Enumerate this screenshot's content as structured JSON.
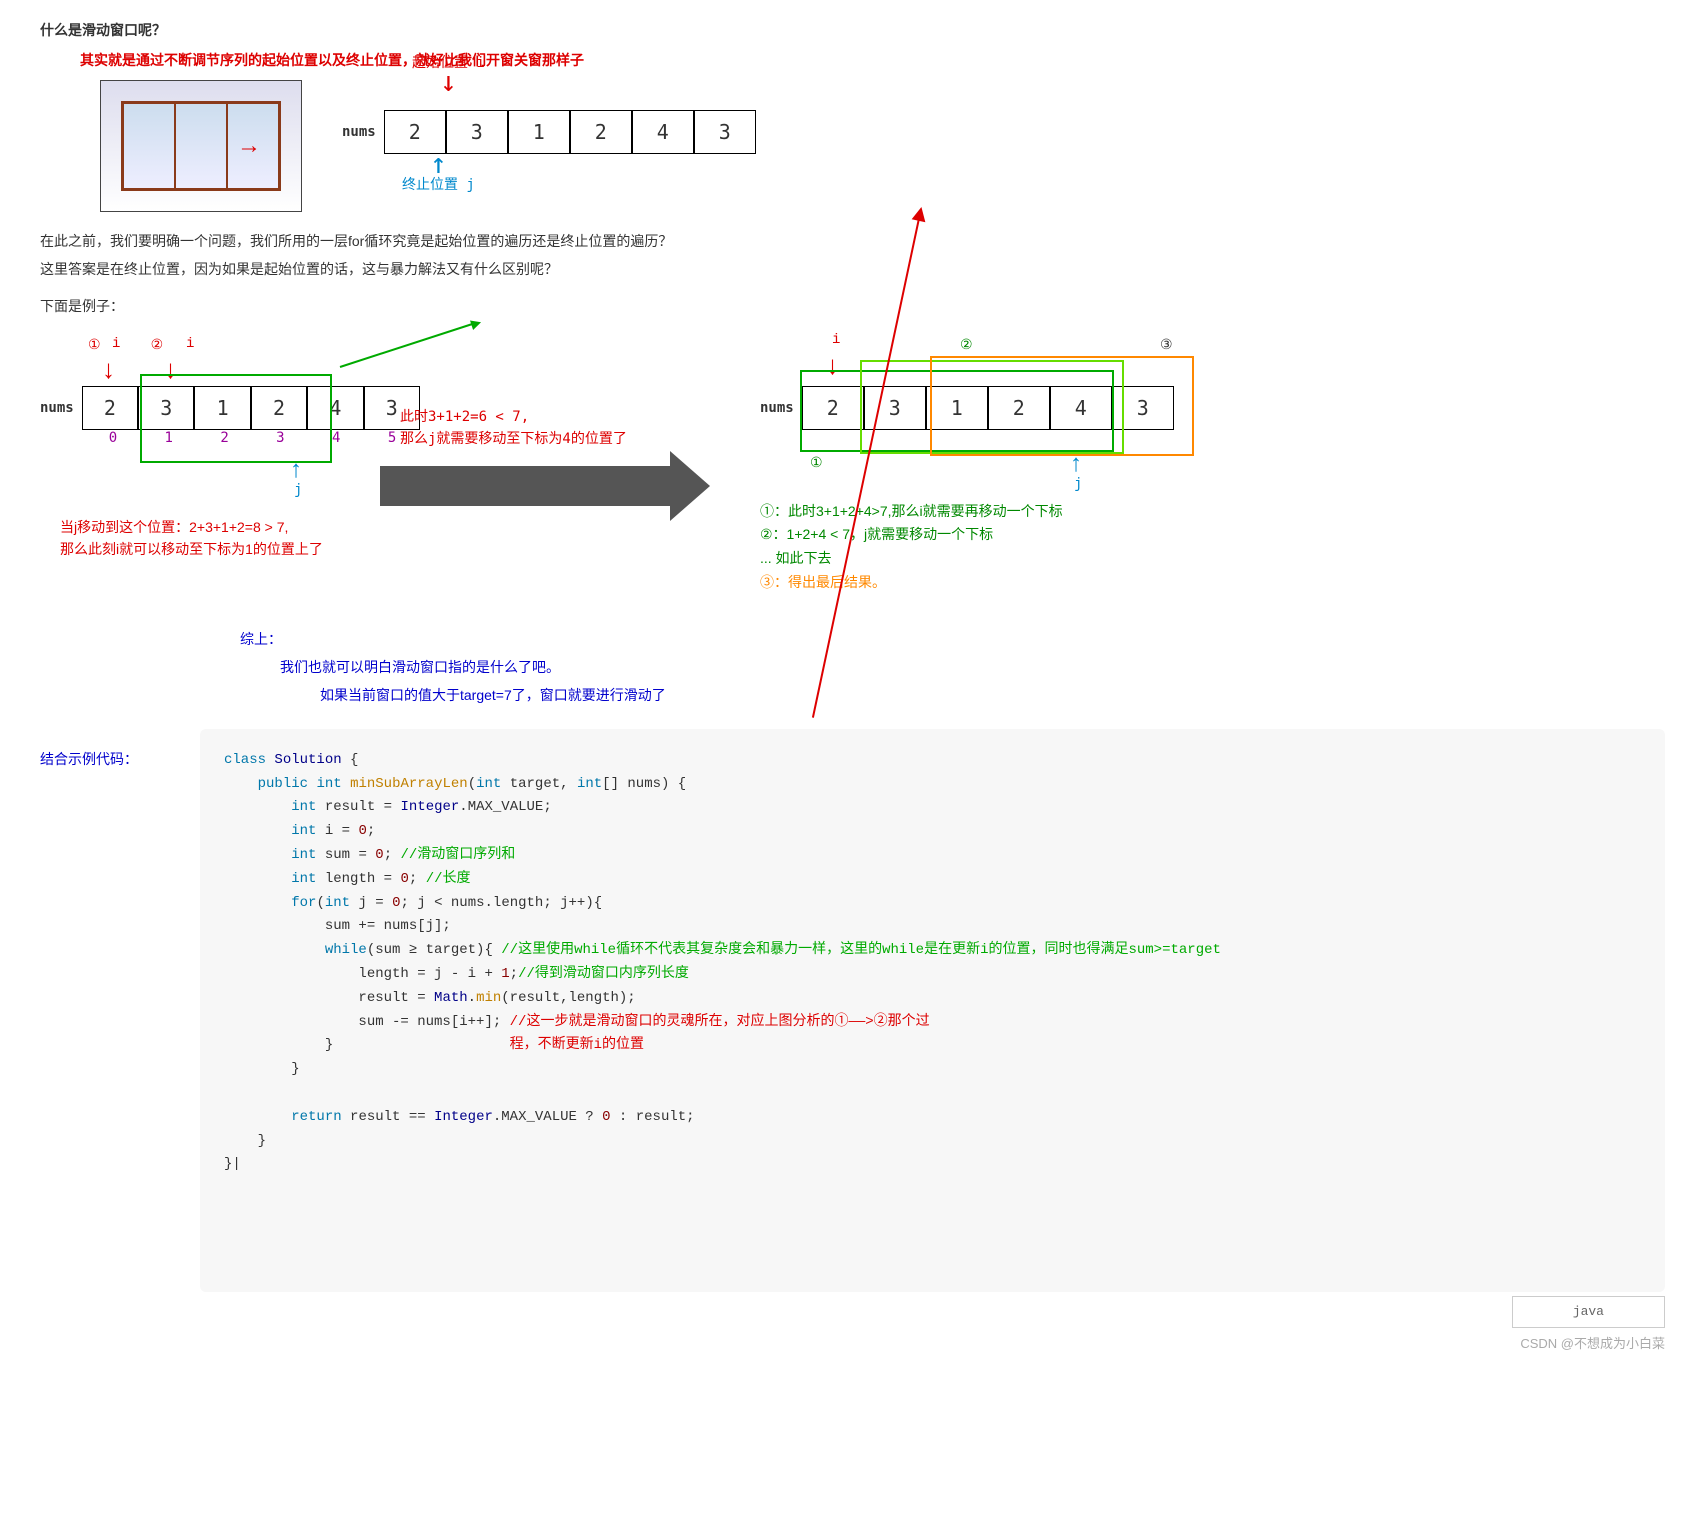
{
  "title": "什么是滑动窗口呢？",
  "intro": "其实就是通过不断调节序列的起始位置以及终止位置，就好比我们开窗关窗那样子",
  "labels": {
    "nums": "nums",
    "start_i": "起始位置 i",
    "end_j": "终止位置 j",
    "i": "i",
    "j": "j"
  },
  "array1": {
    "cells": [
      "2",
      "3",
      "1",
      "2",
      "4",
      "3"
    ]
  },
  "para_a": "在此之前，我们要明确一个问题，我们所用的一层for循环究竟是起始位置的遍历还是终止位置的遍历？",
  "para_b": "这里答案是在终止位置，因为如果是起始位置的话，这与暴力解法又有什么区别呢？",
  "example_title": "下面是例子：",
  "left_array": {
    "circ1": "①",
    "circ2": "②",
    "cells": [
      "2",
      "3",
      "1",
      "2",
      "4",
      "3"
    ],
    "idx": [
      "0",
      "1",
      "2",
      "3",
      "4",
      "5"
    ]
  },
  "mid_text_l1": "此时3+1+2=6 < 7,",
  "mid_text_l2": "那么j就需要移动至下标为4的位置了",
  "left_note_l1": "当j移动到这个位置：2+3+1+2=8 > 7,",
  "left_note_l2": "那么此刻i就可以移动至下标为1的位置上了",
  "right_array": {
    "circ1": "①",
    "circ2": "②",
    "circ3": "③",
    "cells": [
      "2",
      "3",
      "1",
      "2",
      "4",
      "3"
    ]
  },
  "right_notes": {
    "n1": "①：此时3+1+2+4>7,那么i就需要再移动一个下标",
    "n2": "②：1+2+4 < 7，j就需要移动一个下标",
    "n3": "... 如此下去",
    "n4": "③：得出最后结果。"
  },
  "summary": {
    "s1": "综上：",
    "s2": "我们也就可以明白滑动窗口指的是什么了吧。",
    "s3": "如果当前窗口的值大于target=7了，窗口就要进行滑动了"
  },
  "code_label": "结合示例代码：",
  "code": {
    "c1": "class",
    "c2": "Solution",
    "c3": "public",
    "c4": "int",
    "c5": "minSubArrayLen",
    "c6": "target",
    "c7": "nums",
    "c8": "result",
    "c9": "Integer",
    "c10": "MAX_VALUE",
    "c11": "i",
    "c12": "sum",
    "c13": "length",
    "c14": "for",
    "c15": "j",
    "c16": "while",
    "c17": "Math",
    "c18": "min",
    "c19": "return",
    "zero": "0",
    "one": "1",
    "cmt_sum": "//滑动窗口序列和",
    "cmt_len": "//长度",
    "cmt_while": "//这里使用while循环不代表其复杂度会和暴力一样，这里的while是在更新i的位置，同时也得满足sum>=target",
    "cmt_wlen": "//得到滑动窗口内序列长度",
    "cmt_soul1": "//这一步就是滑动窗口的灵魂所在，对应上图分析的①——>②那个过",
    "cmt_soul2": "程，不断更新i的位置"
  },
  "lang": "java",
  "watermark": "CSDN @不想成为小白菜"
}
